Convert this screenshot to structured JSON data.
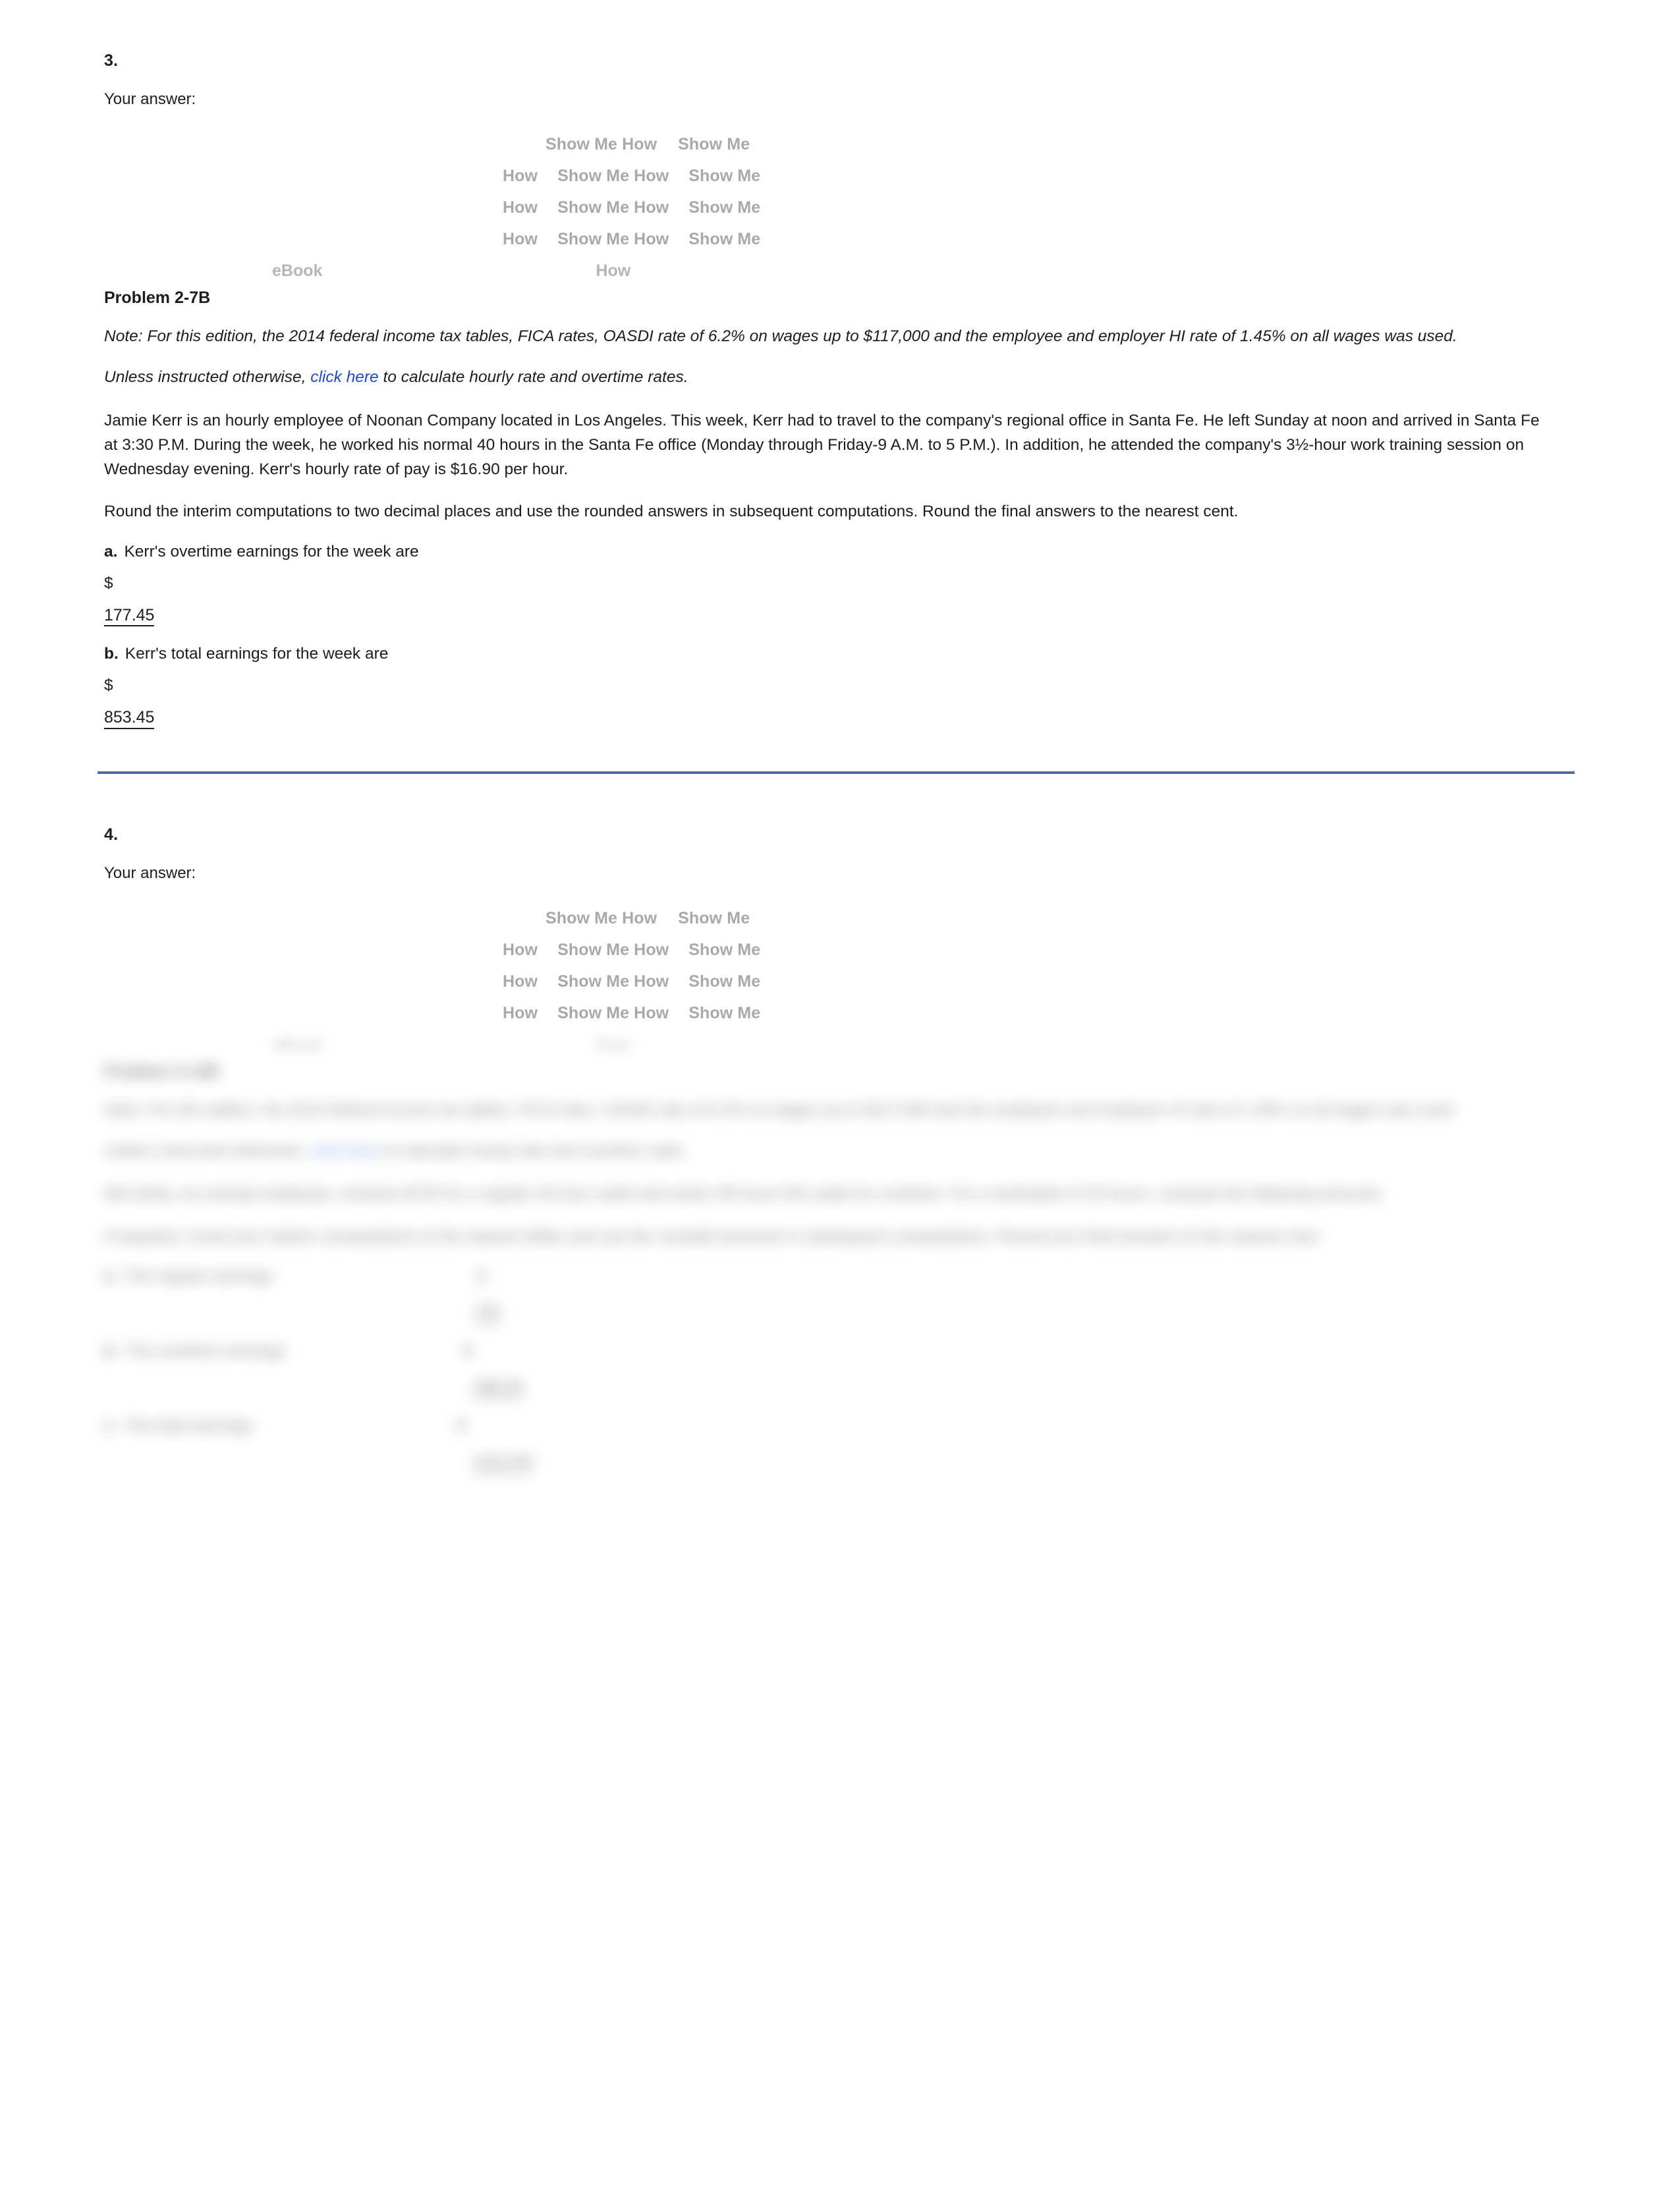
{
  "document": {
    "background": "#ffffff",
    "divider_color": "#5568ad",
    "link_color": "#1a49db",
    "muted_button_color": "#a9a9a9"
  },
  "questions": [
    {
      "number": "3.",
      "your_answer_label": "Your answer:",
      "tool_buttons": {
        "rows": [
          [
            "Show Me How",
            "Show Me"
          ],
          [
            "How",
            "Show Me How",
            "Show Me"
          ],
          [
            "How",
            "Show Me How",
            "Show Me"
          ],
          [
            "How",
            "Show Me How",
            "Show Me"
          ]
        ],
        "ebook_label": "eBook",
        "trailing_how": "How"
      },
      "problem_title": "Problem 2-7B",
      "note": "Note: For this edition, the 2014 federal income tax tables, FICA rates, OASDI rate of 6.2% on wages up to $117,000 and the employee and employer HI rate of 1.45% on all wages was used.",
      "instruction_prefix": "Unless instructed otherwise, ",
      "instruction_link": "click here",
      "instruction_suffix": " to calculate hourly rate and overtime rates.",
      "body": "Jamie Kerr is an hourly employee of Noonan Company located in Los Angeles. This week, Kerr had to travel to the company's regional office in Santa Fe. He left Sunday at noon and arrived in Santa Fe at 3:30 P.M. During the week, he worked his normal 40 hours in the Santa Fe office (Monday through Friday-9 A.M. to 5 P.M.). In addition, he attended the company's 3½-hour work training session on Wednesday evening. Kerr's hourly rate of pay is $16.90 per hour.",
      "rounding": "Round the interim computations to two decimal places and use the rounded answers in subsequent computations. Round the final answers to the nearest cent.",
      "parts": [
        {
          "label": "a.",
          "text": "Kerr's overtime earnings for the week are",
          "currency": "$",
          "value": "177.45"
        },
        {
          "label": "b.",
          "text": "Kerr's total earnings for the week are",
          "currency": "$",
          "value": "853.45"
        }
      ]
    },
    {
      "number": "4.",
      "your_answer_label": "Your answer:",
      "tool_buttons": {
        "rows": [
          [
            "Show Me How",
            "Show Me"
          ],
          [
            "How",
            "Show Me How",
            "Show Me"
          ],
          [
            "How",
            "Show Me How",
            "Show Me"
          ],
          [
            "How",
            "Show Me How",
            "Show Me"
          ]
        ],
        "ebook_label": "eBook",
        "trailing_how": "How"
      },
      "problem_title": "Problem 2-12B",
      "note": "Note: For this edition, the 2014 federal income tax tables, FICA rates, OASDI rate of 6.2% on wages up to $117,000 and the employee and employer HI rate of 1.45% on all wages was used.",
      "instruction_prefix": "Unless instructed otherwise, ",
      "instruction_link": "click here",
      "instruction_suffix": " to calculate hourly rate and overtime rates.",
      "body": "McCarthy, an exempt employee, receives $725 for a regular 40-hour week and works 48 hours this week for overtime. For a workweek of 40 hours, compute the following amounts.",
      "rounding": "If required, round your interim computations to the nearest dollar and use the rounded amounts in subsequent computations. Round your final answers to the nearest cent.",
      "parts": [
        {
          "label": "a.",
          "text": "The regular earnings",
          "currency": "$",
          "value": "725"
        },
        {
          "label": "b.",
          "text": "The overtime earnings",
          "currency": "$",
          "value": "288.00"
        },
        {
          "label": "c.",
          "text": "The total earnings",
          "currency": "$",
          "value": "1013.00"
        }
      ]
    }
  ]
}
